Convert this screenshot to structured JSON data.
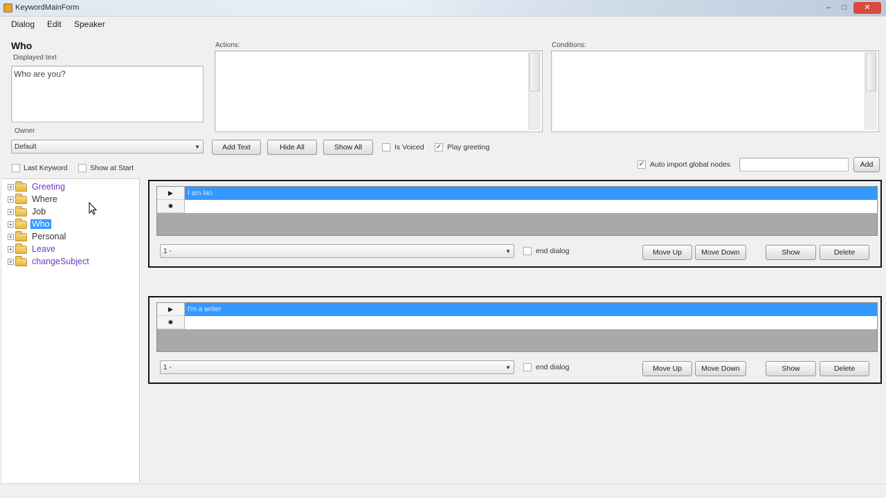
{
  "window": {
    "title": "KeywordMainForm",
    "minimize": "–",
    "maximize": "□",
    "close": "✕"
  },
  "menu": [
    "Dialog",
    "Edit",
    "Speaker"
  ],
  "node_title": "Who",
  "displayed_text": {
    "label": "Displayed text",
    "value": "Who are you?"
  },
  "actions": {
    "label": "Actions:"
  },
  "conditions": {
    "label": "Conditions:"
  },
  "owner": {
    "label": "Owner",
    "value": "Default"
  },
  "buttons": {
    "add_text": "Add Text",
    "hide_all": "Hide All",
    "show_all": "Show All",
    "add": "Add"
  },
  "checks": {
    "is_voiced": {
      "label": "Is Voiced",
      "checked": false
    },
    "play_greeting": {
      "label": "Play greeting",
      "checked": true
    },
    "last_keyword": {
      "label": "Last Keyword",
      "checked": false
    },
    "show_at_start": {
      "label": "Show at Start",
      "checked": false
    },
    "auto_import": {
      "label": "Auto import global nodes",
      "checked": true
    }
  },
  "auto_import_value": "",
  "tree": [
    {
      "label": "Greeting",
      "selected": false
    },
    {
      "label": "Where",
      "selected": false
    },
    {
      "label": "Job",
      "selected": false
    },
    {
      "label": "Who",
      "selected": true
    },
    {
      "label": "Personal",
      "selected": false
    },
    {
      "label": "Leave",
      "selected": false
    },
    {
      "label": "changeSubject",
      "selected": false
    }
  ],
  "responses": [
    {
      "row_markers": [
        "▶",
        "✱"
      ],
      "rows": [
        "I am Ian",
        ""
      ],
      "combo": "1 -",
      "end_dialog": {
        "label": "end dialog",
        "checked": false
      },
      "buttons": {
        "move_up": "Move Up",
        "move_down": "Move Down",
        "show": "Show",
        "delete": "Delete"
      }
    },
    {
      "row_markers": [
        "▶",
        "✱"
      ],
      "rows": [
        "I'm a writer",
        ""
      ],
      "combo": "1 -",
      "end_dialog": {
        "label": "end dialog",
        "checked": false
      },
      "buttons": {
        "move_up": "Move Up",
        "move_down": "Move Down",
        "show": "Show",
        "delete": "Delete"
      }
    }
  ],
  "combo_arrow": "▼",
  "expander": "+"
}
